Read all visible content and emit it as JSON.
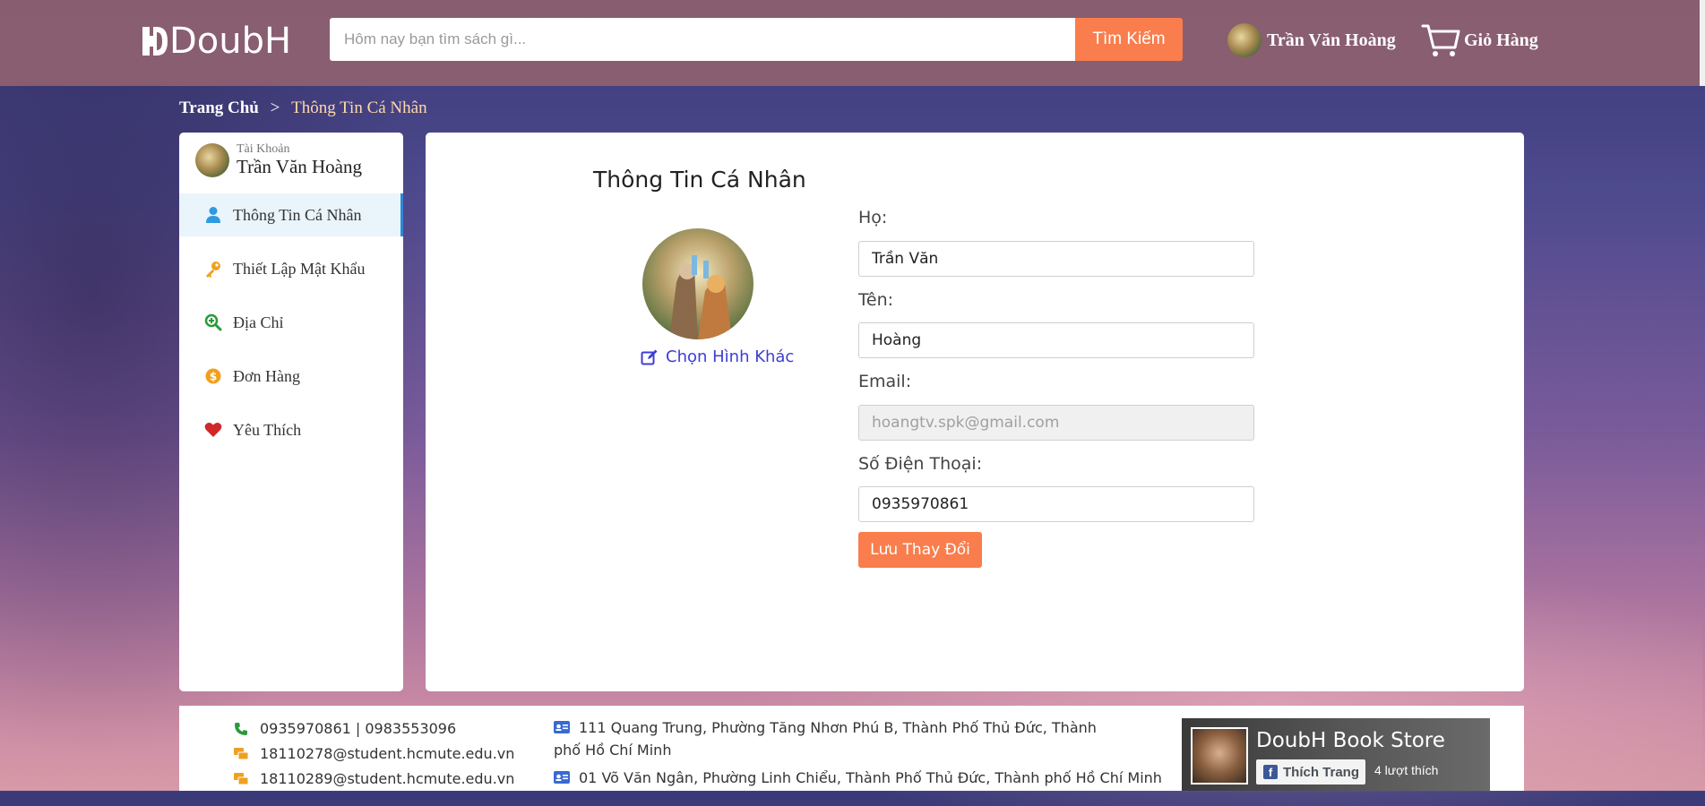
{
  "header": {
    "logo_text": "DoubH",
    "search_placeholder": "Hôm nay bạn tìm sách gì...",
    "search_button": "Tìm Kiếm",
    "user_name": "Trần Văn Hoàng",
    "cart_label": "Giỏ Hàng"
  },
  "breadcrumb": {
    "home": "Trang Chủ",
    "separator": ">",
    "current": "Thông Tin Cá Nhân"
  },
  "sidebar": {
    "account_label": "Tài Khoản",
    "user_name": "Trần Văn Hoàng",
    "items": [
      {
        "label": "Thông Tin Cá Nhân",
        "icon": "user-icon",
        "color": "#2f9ae0",
        "active": true
      },
      {
        "label": "Thiết Lập Mật Khẩu",
        "icon": "key-icon",
        "color": "#f0a020",
        "active": false
      },
      {
        "label": "Địa Chỉ",
        "icon": "location-search-icon",
        "color": "#2a9a3a",
        "active": false
      },
      {
        "label": "Đơn Hàng",
        "icon": "coin-icon",
        "color": "#f0a020",
        "active": false
      },
      {
        "label": "Yêu Thích",
        "icon": "heart-icon",
        "color": "#d02828",
        "active": false
      }
    ]
  },
  "profile": {
    "title": "Thông Tin Cá Nhân",
    "change_picture": "Chọn Hình Khác",
    "fields": {
      "last_name_label": "Họ:",
      "last_name_value": "Trần Văn",
      "first_name_label": "Tên:",
      "first_name_value": "Hoàng",
      "email_label": "Email:",
      "email_value": "hoangtv.spk@gmail.com",
      "phone_label": "Số Điện Thoại:",
      "phone_value": "0935970861"
    },
    "save_button": "Lưu Thay Đổi"
  },
  "footer": {
    "phone": "0935970861 | 0983553096",
    "email_1": "18110278@student.hcmute.edu.vn",
    "email_2": "18110289@student.hcmute.edu.vn",
    "address_1": "111 Quang Trung, Phường Tăng Nhơn Phú B, Thành Phố Thủ Đức, Thành phố Hồ Chí Minh",
    "address_2": "01 Võ Văn Ngân, Phường Linh Chiểu, Thành Phố Thủ Đức, Thành phố Hồ Chí Minh",
    "fb_page_name": "DoubH Book Store",
    "fb_like_label": "Thích Trang",
    "fb_like_count": "4 lượt thích"
  },
  "colors": {
    "accent": "#f97d4d",
    "link": "#3d3dd6",
    "active_border": "#2f86d6"
  }
}
